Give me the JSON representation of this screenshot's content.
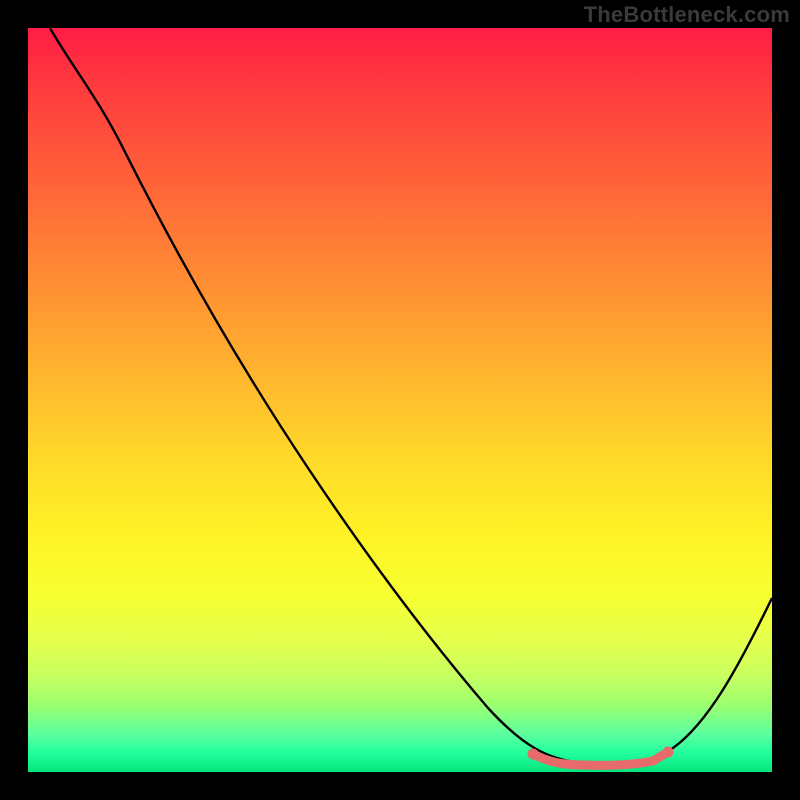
{
  "watermark": "TheBottleneck.com",
  "chart_data": {
    "type": "line",
    "title": "",
    "xlabel": "",
    "ylabel": "",
    "xlim": [
      0,
      100
    ],
    "ylim": [
      0,
      100
    ],
    "grid": false,
    "series": [
      {
        "name": "curve",
        "color": "#000000",
        "x": [
          3,
          8,
          14,
          20,
          28,
          36,
          44,
          52,
          58,
          62,
          66,
          70,
          74,
          78,
          82,
          86,
          90,
          94,
          98,
          100
        ],
        "y": [
          100,
          96,
          90,
          82,
          70,
          58,
          46,
          34,
          24,
          16,
          10,
          6,
          3,
          1.5,
          1.2,
          1.5,
          4,
          10,
          20,
          28
        ]
      },
      {
        "name": "highlight",
        "color": "#e96a6a",
        "x": [
          70,
          72,
          74,
          76,
          78,
          80,
          82,
          84,
          86,
          88
        ],
        "y": [
          6,
          4,
          3,
          2,
          1.5,
          1.2,
          1.2,
          1.4,
          1.6,
          3
        ]
      }
    ],
    "background_gradient": {
      "top": "#ff1c46",
      "mid": "#ffe22a",
      "bottom": "#06e47c"
    }
  }
}
